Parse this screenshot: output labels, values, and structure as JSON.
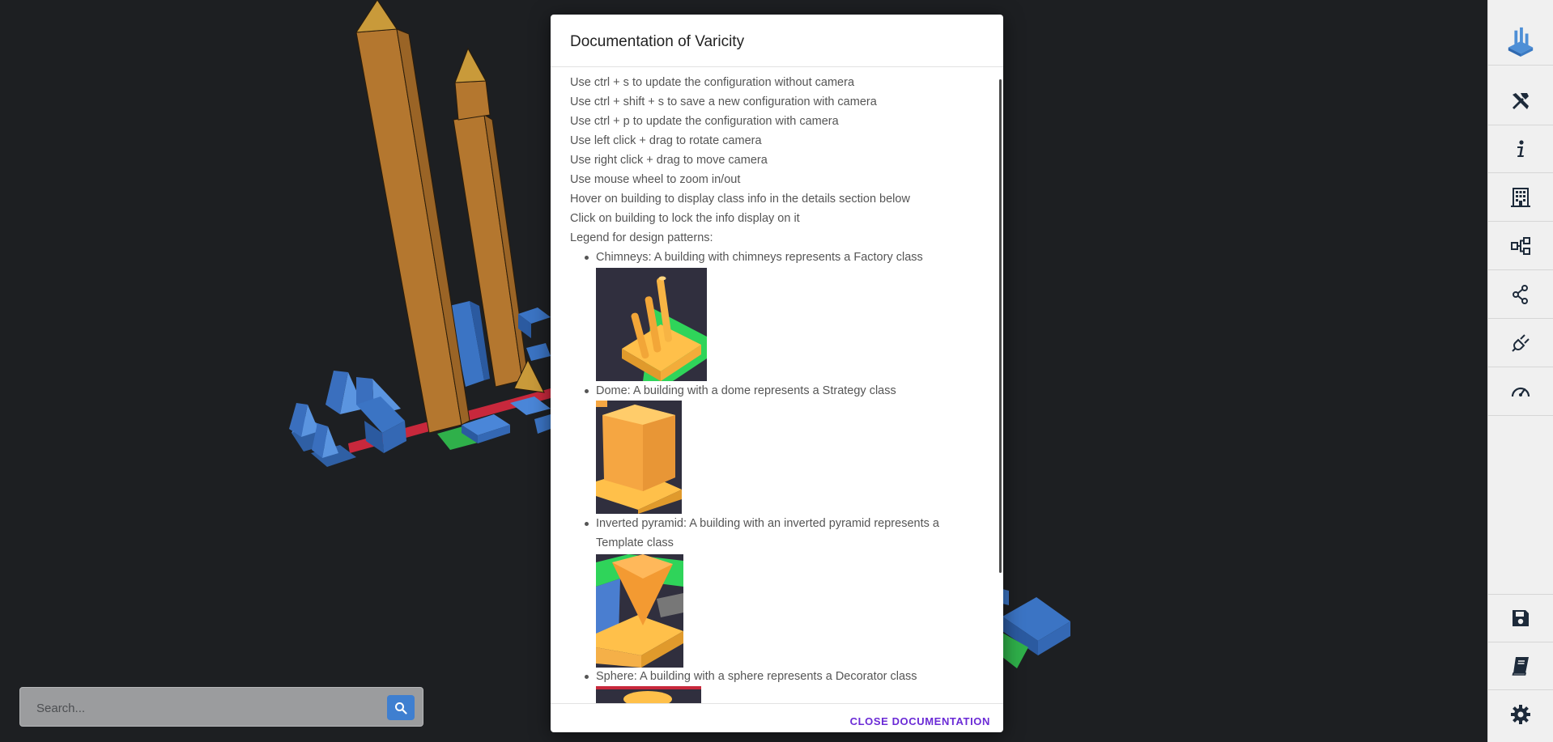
{
  "modal": {
    "title": "Documentation of Varicity",
    "lines": [
      "Use ctrl + s to update the configuration without camera",
      "Use ctrl + shift + s to save a new configuration with camera",
      "Use ctrl + p to update the configuration with camera",
      "Use left click + drag to rotate camera",
      "Use right click + drag to move camera",
      "Use mouse wheel to zoom in/out",
      "Hover on building to display class info in the details section below",
      "Click on building to lock the info display on it",
      "Legend for design patterns:"
    ],
    "patterns": [
      {
        "text": "Chimneys: A building with chimneys represents a Factory class"
      },
      {
        "text": "Dome: A building with a dome represents a Strategy class"
      },
      {
        "text_line1": "Inverted pyramid: A building with an inverted pyramid represents a",
        "text_line2": "Template class"
      },
      {
        "text": "Sphere: A building with a sphere represents a Decorator class"
      }
    ],
    "close_label": "CLOSE DOCUMENTATION"
  },
  "search": {
    "placeholder": "Search..."
  },
  "toolbar": {
    "items": [
      {
        "icon": "varicity-logo-icon"
      },
      {
        "icon": "tools-icon"
      },
      {
        "icon": "info-icon"
      },
      {
        "icon": "building-icon"
      },
      {
        "icon": "hierarchy-icon"
      },
      {
        "icon": "share-icon"
      },
      {
        "icon": "plug-icon"
      },
      {
        "icon": "speedometer-icon"
      },
      {
        "icon": "save-icon"
      },
      {
        "icon": "book-icon"
      },
      {
        "icon": "settings-icon"
      }
    ]
  },
  "colors": {
    "background": "#1d1f22",
    "building_orange": "#b4772f",
    "building_blue": "#3b74c4",
    "road_red": "#c8283c",
    "road_green": "#2fb04a",
    "toolbar_icon": "#1d2a3a",
    "accent_purple": "#6b2bd6",
    "search_button": "#3f7fd0"
  }
}
